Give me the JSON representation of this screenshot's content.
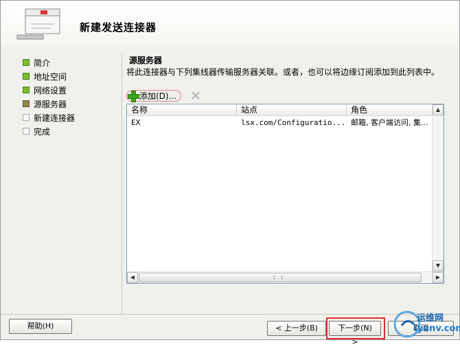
{
  "wizard": {
    "title": "新建发送连接器"
  },
  "nav": {
    "items": [
      {
        "label": "简介",
        "state": "done"
      },
      {
        "label": "地址空间",
        "state": "done"
      },
      {
        "label": "网络设置",
        "state": "done"
      },
      {
        "label": "源服务器",
        "state": "current"
      },
      {
        "label": "新建连接器",
        "state": "todo"
      },
      {
        "label": "完成",
        "state": "todo"
      }
    ]
  },
  "content": {
    "section_title": "源服务器",
    "description": "将此连接器与下列集线器传输服务器关联。或者，也可以将边缘订阅添加到此列表中。",
    "toolbar": {
      "add_label": "添加(D)...",
      "remove_icon": "delete-x-icon",
      "add_icon": "green-plus-icon"
    },
    "list": {
      "columns": [
        "名称",
        "站点",
        "角色"
      ],
      "rows": [
        {
          "name": "EX",
          "site": "lsx.com/Configuratio...",
          "role": "邮箱, 客户端访问, 集..."
        }
      ]
    }
  },
  "buttons": {
    "help": "帮助(H)",
    "back": "< 上一步(B)",
    "next": "下一步(N) >",
    "cancel": "取消"
  },
  "watermark": {
    "line1": "运维网",
    "line2": "iyunv.com"
  },
  "colors": {
    "step_done": "#7bbf2a",
    "step_current": "#8a8a4a",
    "highlight": "#d93030",
    "watermark": "#1a63a8"
  }
}
